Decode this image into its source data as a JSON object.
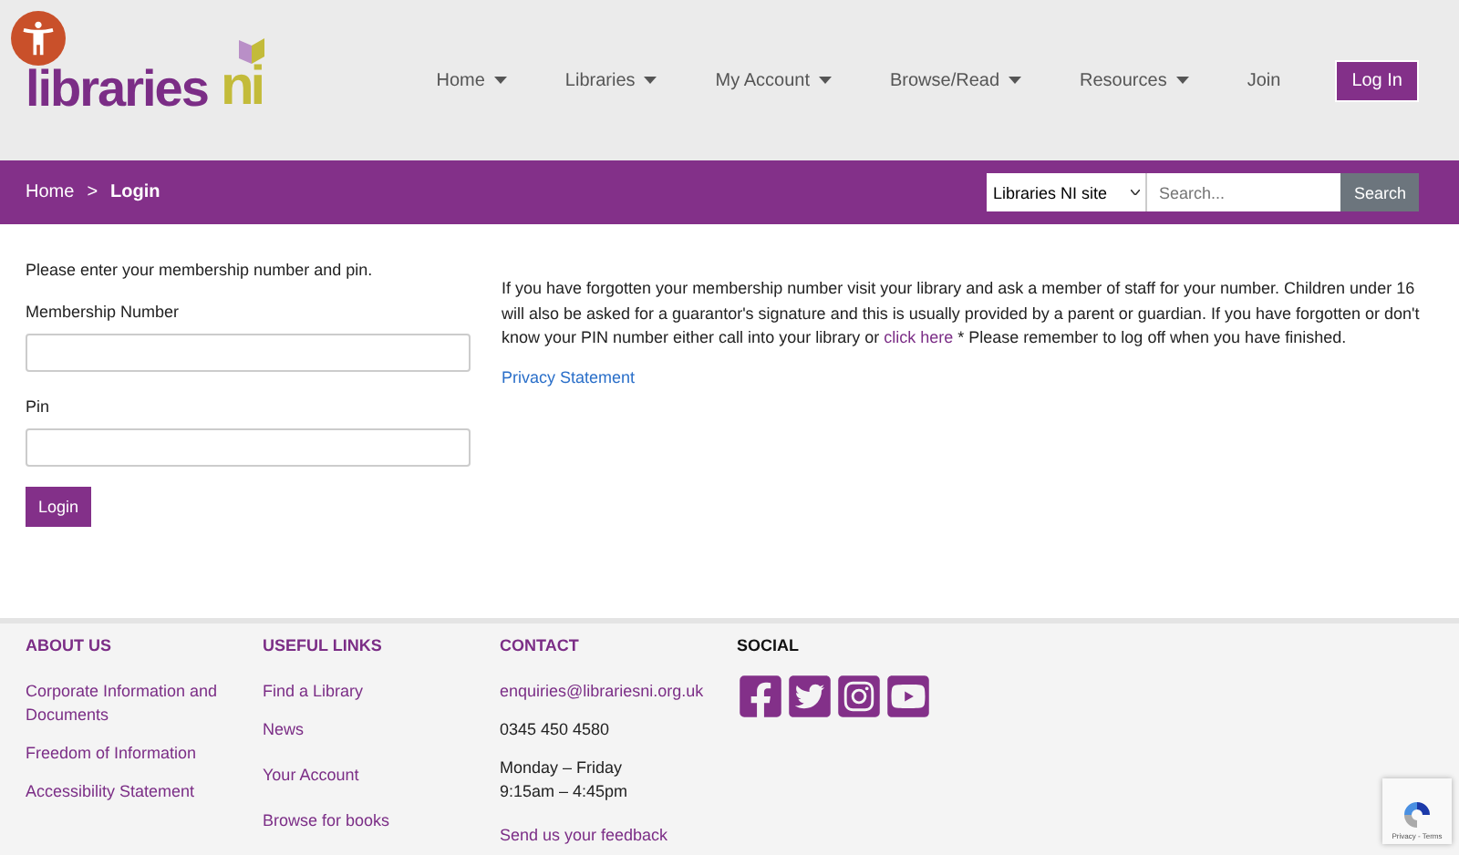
{
  "logo": {
    "word": "libraries",
    "mark": "ni"
  },
  "nav": [
    {
      "label": "Home",
      "dropdown": true
    },
    {
      "label": "Libraries",
      "dropdown": true
    },
    {
      "label": "My Account",
      "dropdown": true
    },
    {
      "label": "Browse/Read",
      "dropdown": true
    },
    {
      "label": "Resources",
      "dropdown": true
    },
    {
      "label": "Join",
      "dropdown": false
    }
  ],
  "login_button": "Log In",
  "breadcrumb": [
    {
      "label": "Home",
      "selected": false
    },
    {
      "label": "Login",
      "selected": true
    }
  ],
  "breadcrumb_separator": ">",
  "search": {
    "scope": "Libraries NI site",
    "placeholder": "Search...",
    "button": "Search"
  },
  "form": {
    "intro": "Please enter your membership number and pin.",
    "fields": [
      {
        "label": "Membership Number"
      },
      {
        "label": "Pin"
      }
    ],
    "submit": "Login"
  },
  "help": {
    "before": "If you have forgotten your membership number visit your library and ask a member of staff for your number. Children under 16 will also be asked for a guarantor's signature and this is usually provided by a parent or guardian. If you have forgotten or don't know your PIN number either call into your library or",
    "link": "click here",
    "after": "* Please remember to log off when you have finished.",
    "privacy": "Privacy Statement"
  },
  "footer": {
    "columns": [
      {
        "heading": "ABOUT US",
        "kind": "links",
        "items": [
          "Corporate Information and Documents",
          "Freedom of Information",
          "Accessibility Statement"
        ]
      },
      {
        "heading": "USEFUL LINKS",
        "kind": "links",
        "items": [
          "Find a Library",
          "News",
          "Your Account",
          "Browse for books"
        ]
      },
      {
        "heading": "CONTACT",
        "kind": "contact",
        "items": [
          "enquiries@librariesni.org.uk",
          "0345 450 4580",
          "Monday – Friday\n9:15am – 4:45pm",
          "Send us your feedback"
        ]
      },
      {
        "heading": "SOCIAL",
        "kind": "social",
        "items": [
          {
            "kind": "facebook"
          },
          {
            "kind": "twitter"
          },
          {
            "kind": "instagram"
          },
          {
            "kind": "youtube"
          }
        ]
      }
    ]
  },
  "recaptcha": {
    "text": "Privacy - Terms"
  }
}
